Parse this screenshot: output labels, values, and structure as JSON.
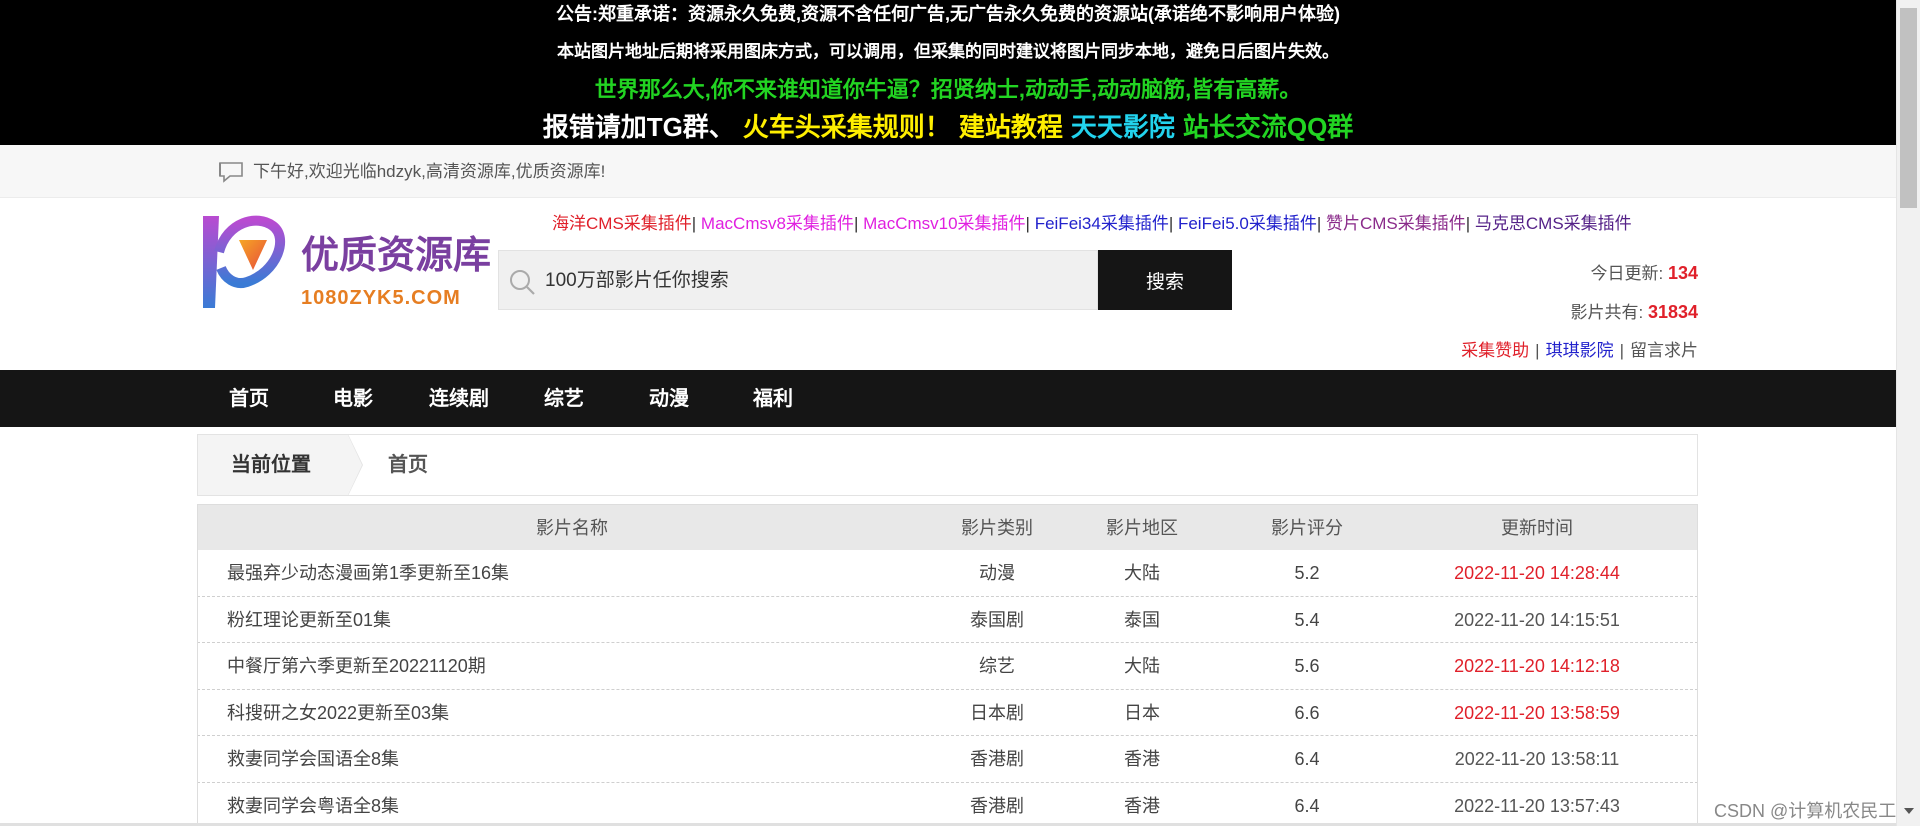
{
  "notice": {
    "line1": "公告:郑重承诺：资源永久免费,资源不含任何广告,无广告永久免费的资源站(承诺绝不影响用户体验)",
    "line2": "本站图片地址后期将采用图床方式，可以调用，但采集的同时建议将图片同步本地，避免日后图片失效。",
    "line3": "世界那么大,你不来谁知道你牛逼？招贤纳士,动动手,动动脑筋,皆有高薪。",
    "line4": [
      {
        "text": "报错请加TG群、",
        "color": "#ffffff"
      },
      {
        "text": "火车头采集规则！",
        "color": "#ffef00"
      },
      {
        "text": "建站教程",
        "color": "#ffef00"
      },
      {
        "text": "天天影院",
        "color": "#22d3ee"
      },
      {
        "text": "站长交流QQ群",
        "color": "#22d422"
      }
    ]
  },
  "welcome": {
    "icon": "chat-bubble-icon",
    "text": "下午好,欢迎光临hdzyk,高清资源库,优质资源库!"
  },
  "logo": {
    "title": "优质资源库",
    "domain": "1080ZYK5.COM"
  },
  "plugins": [
    {
      "label": "海洋CMS采集插件",
      "color": "#e0202a"
    },
    {
      "label": "MacCmsv8采集插件",
      "color": "#e020e0"
    },
    {
      "label": "MacCmsv10采集插件",
      "color": "#e020e0"
    },
    {
      "label": "FeiFei34采集插件",
      "color": "#2222cc"
    },
    {
      "label": "FeiFei5.0采集插件",
      "color": "#2222cc"
    },
    {
      "label": "赞片CMS采集插件",
      "color": "#8a2b8a"
    },
    {
      "label": "马克思CMS采集插件",
      "color": "#552288"
    }
  ],
  "search": {
    "placeholder": "100万部影片任你搜索",
    "button_label": "搜索",
    "icon": "search-icon"
  },
  "stats": {
    "today_label": "今日更新:",
    "today_value": "134",
    "total_label": "影片共有:",
    "total_value": "31834",
    "links": [
      {
        "label": "采集赞助",
        "color": "#e0202a"
      },
      {
        "label": "琪琪影院",
        "color": "#2222cc"
      },
      {
        "label": "留言求片",
        "color": "#555555"
      }
    ],
    "sep": "|"
  },
  "nav": {
    "items": [
      "首页",
      "电影",
      "连续剧",
      "综艺",
      "动漫",
      "福利"
    ]
  },
  "breadcrumb": {
    "label": "当前位置",
    "current": "首页"
  },
  "table": {
    "headers": [
      "影片名称",
      "影片类别",
      "影片地区",
      "影片评分",
      "更新时间"
    ],
    "rows": [
      {
        "name": "最强弃少动态漫画第1季更新至16集",
        "type": "动漫",
        "area": "大陆",
        "score": "5.2",
        "time": "2022-11-20 14:28:44",
        "new": true
      },
      {
        "name": "粉红理论更新至01集",
        "type": "泰国剧",
        "area": "泰国",
        "score": "5.4",
        "time": "2022-11-20 14:15:51",
        "new": false
      },
      {
        "name": "中餐厅第六季更新至20221120期",
        "type": "综艺",
        "area": "大陆",
        "score": "5.6",
        "time": "2022-11-20 14:12:18",
        "new": true
      },
      {
        "name": "科搜研之女2022更新至03集",
        "type": "日本剧",
        "area": "日本",
        "score": "6.6",
        "time": "2022-11-20 13:58:59",
        "new": true
      },
      {
        "name": "救妻同学会国语全8集",
        "type": "香港剧",
        "area": "香港",
        "score": "6.4",
        "time": "2022-11-20 13:58:11",
        "new": false
      },
      {
        "name": "救妻同学会粤语全8集",
        "type": "香港剧",
        "area": "香港",
        "score": "6.4",
        "time": "2022-11-20 13:57:43",
        "new": false
      }
    ]
  },
  "watermark": "CSDN @计算机农民工",
  "colors": {
    "accent_red": "#e0202a",
    "nav_bg": "#151515",
    "notice_bg": "#000000"
  }
}
